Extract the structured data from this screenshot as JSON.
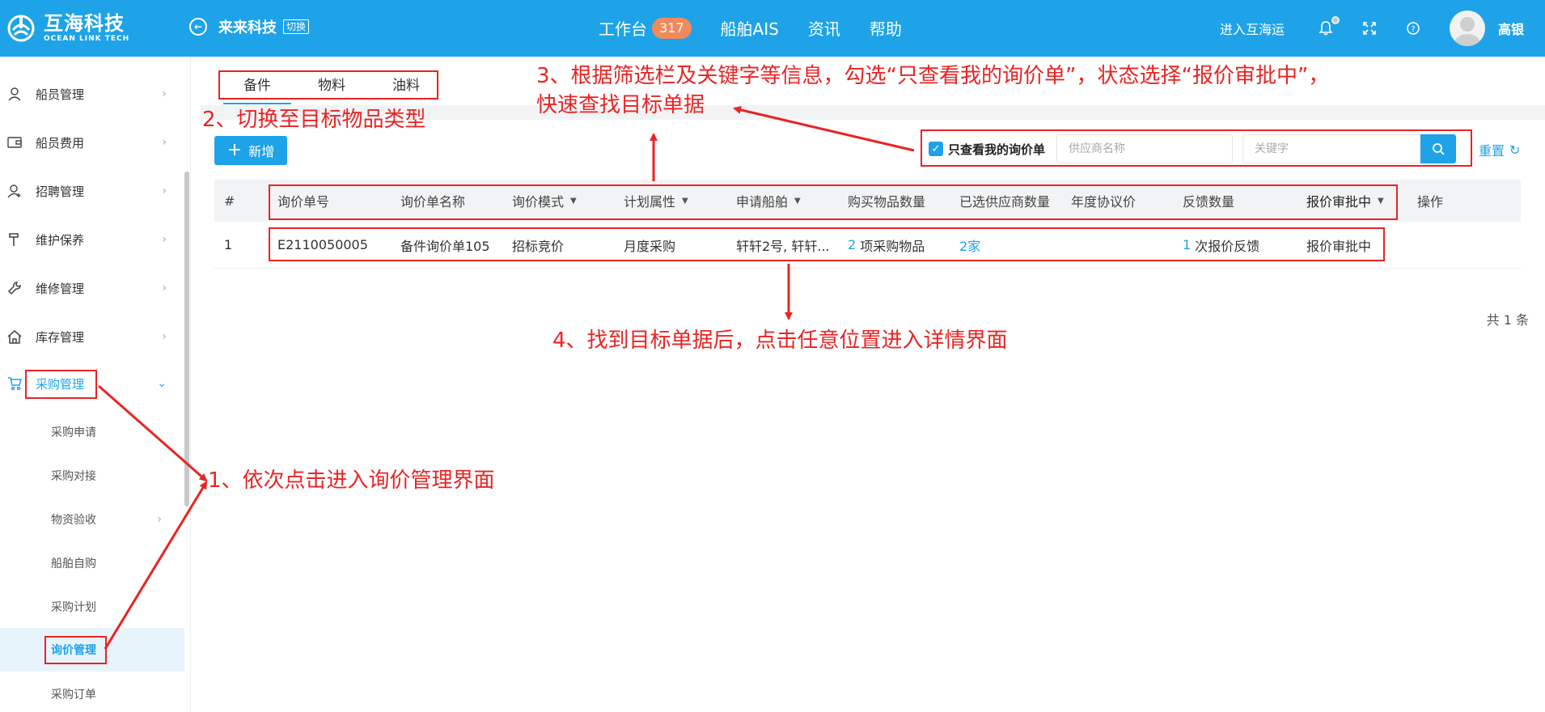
{
  "header": {
    "logo_cn": "互海科技",
    "logo_en": "OCEAN LINK TECH",
    "company": "来来科技",
    "switch_label": "切换",
    "nav": [
      {
        "label": "工作台",
        "badge": "317"
      },
      {
        "label": "船舶AIS"
      },
      {
        "label": "资讯"
      },
      {
        "label": "帮助"
      }
    ],
    "enter_link": "进入互海运",
    "username": "高银"
  },
  "sidebar": {
    "items": [
      {
        "label": "船员管理",
        "icon": "person-icon"
      },
      {
        "label": "船员费用",
        "icon": "wallet-icon"
      },
      {
        "label": "招聘管理",
        "icon": "person-add-icon"
      },
      {
        "label": "维护保养",
        "icon": "hammer-icon"
      },
      {
        "label": "维修管理",
        "icon": "wrench-icon"
      },
      {
        "label": "库存管理",
        "icon": "home-icon"
      },
      {
        "label": "采购管理",
        "icon": "cart-icon",
        "expanded": true
      }
    ],
    "subitems": [
      {
        "label": "采购申请"
      },
      {
        "label": "采购对接"
      },
      {
        "label": "物资验收",
        "has_arrow": true
      },
      {
        "label": "船舶自购"
      },
      {
        "label": "采购计划"
      },
      {
        "label": "询价管理",
        "active": true
      },
      {
        "label": "采购订单"
      }
    ]
  },
  "tabs": [
    "备件",
    "物料",
    "油料"
  ],
  "toolbar": {
    "add_label": "新增"
  },
  "filters": {
    "only_mine_label": "只查看我的询价单",
    "only_mine_checked": true,
    "supplier_placeholder": "供应商名称",
    "keyword_placeholder": "关键字",
    "reset_label": "重置"
  },
  "table": {
    "headers": [
      "#",
      "询价单号",
      "询价单名称",
      "询价模式",
      "计划属性",
      "申请船舶",
      "购买物品数量",
      "已选供应商数量",
      "年度协议价",
      "反馈数量",
      "报价审批中",
      "操作"
    ],
    "rows": [
      {
        "index": "1",
        "no": "E2110050005",
        "name": "备件询价单105",
        "mode": "招标竞价",
        "plan": "月度采购",
        "ship": "轩轩2号, 轩轩...",
        "items_count": "2",
        "items_text": "项采购物品",
        "suppliers": "2家",
        "annual_price": "",
        "feedback_count": "1",
        "feedback_text": "次报价反馈",
        "status": "报价审批中",
        "action": ""
      }
    ],
    "total": "共 1 条"
  },
  "annotations": {
    "step1": "1、依次点击进入询价管理界面",
    "step2": "2、切换至目标物品类型",
    "step3_line1": "3、根据筛选栏及关键字等信息，勾选“只查看我的询价单”，状态选择“报价审批中”，",
    "step3_line2": "快速查找目标单据",
    "step4": "4、找到目标单据后，点击任意位置进入详情界面",
    "color": "#e82424"
  },
  "colors": {
    "primary": "#1ea3e8",
    "badge": "#f08a5d",
    "annotation": "#e82424"
  }
}
